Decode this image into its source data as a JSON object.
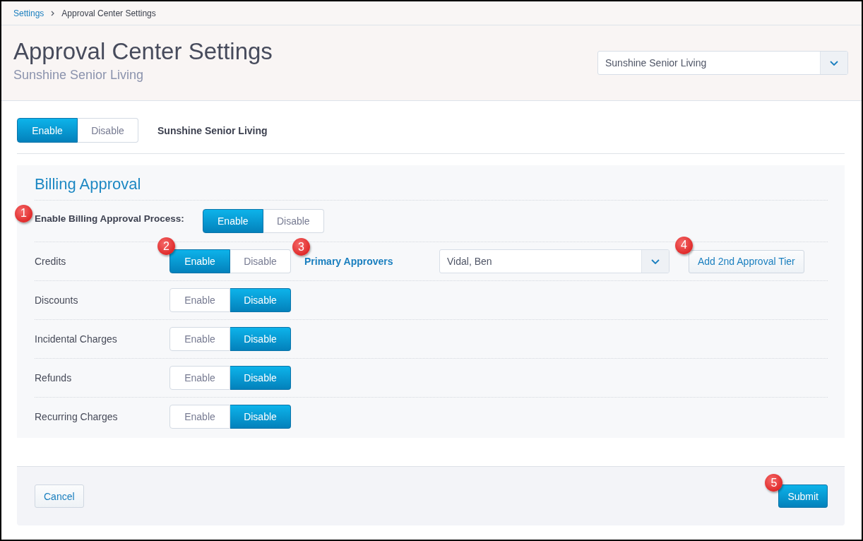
{
  "breadcrumb": [
    {
      "label": "Settings",
      "kind": "link"
    },
    {
      "label": "Approval Center Settings",
      "kind": "current"
    }
  ],
  "header": {
    "title": "Approval Center Settings",
    "subtitle": "Sunshine Senior Living",
    "community_select": {
      "value": "Sunshine Senior Living"
    }
  },
  "community_toggle": {
    "options": [
      {
        "label": "Enable",
        "selected": true
      },
      {
        "label": "Disable",
        "selected": false
      }
    ],
    "label": "Sunshine Senior Living"
  },
  "billing_approval": {
    "title": "Billing Approval",
    "process": {
      "label": "Enable Billing Approval Process:",
      "callout": "1",
      "options": [
        {
          "label": "Enable",
          "selected": true
        },
        {
          "label": "Disable",
          "selected": false
        }
      ]
    },
    "rows": [
      {
        "label": "Credits",
        "callout": "2",
        "options": [
          {
            "label": "Enable",
            "selected": true
          },
          {
            "label": "Disable",
            "selected": false
          }
        ],
        "approvers": {
          "label": "Primary Approvers",
          "callout": "3",
          "select": {
            "value": "Vidal, Ben"
          },
          "add_tier": {
            "label": "Add 2nd Approval Tier",
            "callout": "4"
          }
        }
      },
      {
        "label": "Discounts",
        "options": [
          {
            "label": "Enable",
            "selected": false
          },
          {
            "label": "Disable",
            "selected": true
          }
        ]
      },
      {
        "label": "Incidental Charges",
        "options": [
          {
            "label": "Enable",
            "selected": false
          },
          {
            "label": "Disable",
            "selected": true
          }
        ]
      },
      {
        "label": "Refunds",
        "options": [
          {
            "label": "Enable",
            "selected": false
          },
          {
            "label": "Disable",
            "selected": true
          }
        ]
      },
      {
        "label": "Recurring Charges",
        "options": [
          {
            "label": "Enable",
            "selected": false
          },
          {
            "label": "Disable",
            "selected": true
          }
        ]
      }
    ]
  },
  "footer": {
    "cancel": {
      "label": "Cancel"
    },
    "submit": {
      "label": "Submit",
      "callout": "5"
    }
  }
}
